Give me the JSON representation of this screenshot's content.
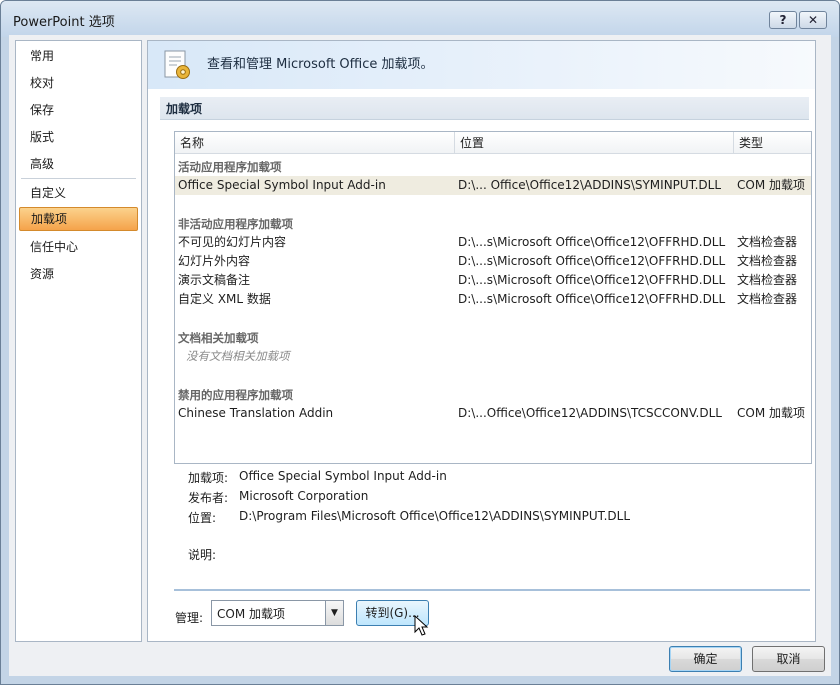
{
  "window": {
    "title": "PowerPoint 选项",
    "help_label": "?",
    "close_label": "✕"
  },
  "nav": {
    "items": [
      {
        "label": "常用"
      },
      {
        "label": "校对"
      },
      {
        "label": "保存"
      },
      {
        "label": "版式"
      },
      {
        "label": "高级"
      },
      {
        "label": "自定义"
      },
      {
        "label": "加载项",
        "selected": true
      },
      {
        "label": "信任中心"
      },
      {
        "label": "资源"
      }
    ]
  },
  "header": {
    "text": "查看和管理 Microsoft Office 加载项。",
    "icon": "addin-gear-icon"
  },
  "section": {
    "title": "加载项"
  },
  "grid": {
    "columns": [
      "名称",
      "位置",
      "类型"
    ],
    "groups": [
      {
        "title": "活动应用程序加载项",
        "rows": [
          {
            "name": "Office Special Symbol Input Add-in",
            "path": "D:\\... Office\\Office12\\ADDINS\\SYMINPUT.DLL",
            "type": "COM 加载项"
          }
        ]
      },
      {
        "title": "非活动应用程序加载项",
        "rows": [
          {
            "name": "不可见的幻灯片内容",
            "path": "D:\\...s\\Microsoft Office\\Office12\\OFFRHD.DLL",
            "type": "文档检查器"
          },
          {
            "name": "幻灯片外内容",
            "path": "D:\\...s\\Microsoft Office\\Office12\\OFFRHD.DLL",
            "type": "文档检查器"
          },
          {
            "name": "演示文稿备注",
            "path": "D:\\...s\\Microsoft Office\\Office12\\OFFRHD.DLL",
            "type": "文档检查器"
          },
          {
            "name": "自定义 XML 数据",
            "path": "D:\\...s\\Microsoft Office\\Office12\\OFFRHD.DLL",
            "type": "文档检查器"
          }
        ]
      },
      {
        "title": "文档相关加载项",
        "empty_text": "没有文档相关加载项"
      },
      {
        "title": "禁用的应用程序加载项",
        "rows": [
          {
            "name": "Chinese Translation Addin",
            "path": "D:\\...Office\\Office12\\ADDINS\\TCSCCONV.DLL",
            "type": "COM 加载项"
          }
        ]
      }
    ]
  },
  "details": {
    "addin_label": "加载项:",
    "addin_value": "Office Special Symbol Input Add-in",
    "publisher_label": "发布者:",
    "publisher_value": "Microsoft Corporation",
    "location_label": "位置:",
    "location_value": "D:\\Program Files\\Microsoft Office\\Office12\\ADDINS\\SYMINPUT.DLL",
    "description_label": "说明:"
  },
  "manage": {
    "label": "管理:",
    "selected": "COM 加载项",
    "goto_label": "转到(G)..."
  },
  "footer": {
    "ok_label": "确定",
    "cancel_label": "取消"
  }
}
